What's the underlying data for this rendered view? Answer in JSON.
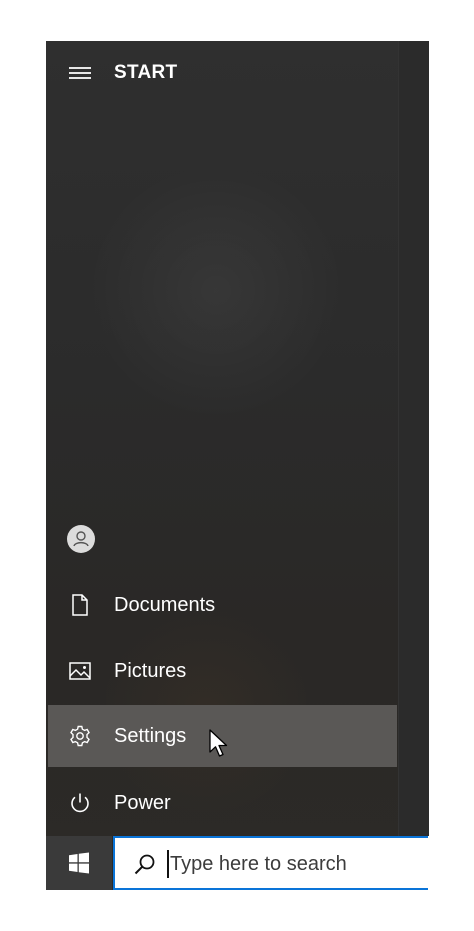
{
  "start_menu": {
    "title": "START",
    "items": [
      {
        "label": "Documents",
        "icon": "document-icon"
      },
      {
        "label": "Pictures",
        "icon": "pictures-icon"
      },
      {
        "label": "Settings",
        "icon": "gear-icon",
        "highlighted": true
      },
      {
        "label": "Power",
        "icon": "power-icon"
      }
    ],
    "account_icon": "user-avatar-icon"
  },
  "taskbar": {
    "start_icon": "windows-logo-icon",
    "search": {
      "placeholder": "Type here to search",
      "value": "",
      "icon": "search-icon"
    }
  },
  "colors": {
    "panel_background": "#2c2c2c",
    "highlight": "#5a5856",
    "search_border": "#0a74d8",
    "text": "#ffffff"
  }
}
